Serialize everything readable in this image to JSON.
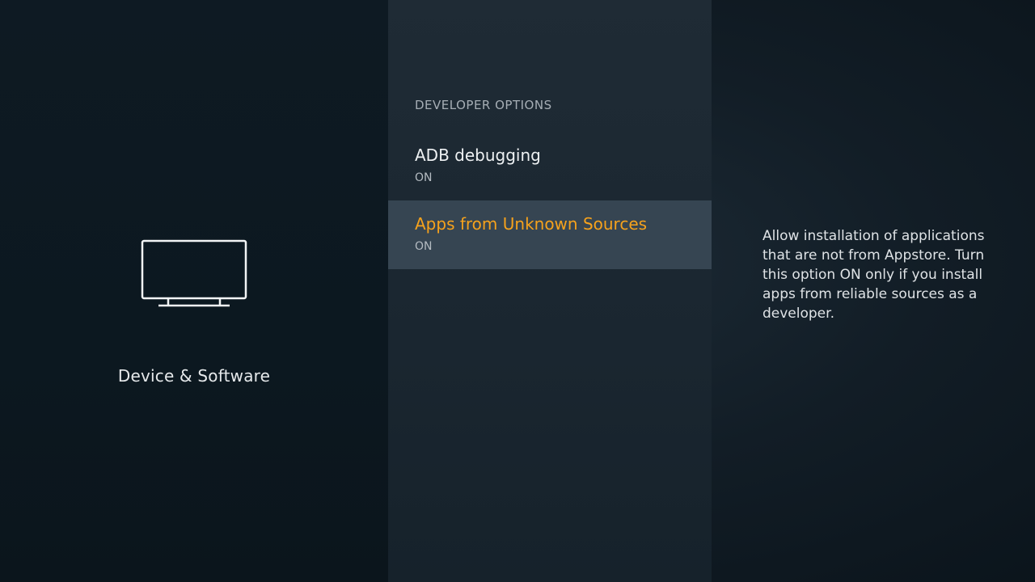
{
  "category": {
    "icon": "tv-icon",
    "label": "Device & Software"
  },
  "section": {
    "header": "DEVELOPER OPTIONS",
    "items": [
      {
        "title": "ADB debugging",
        "status": "ON",
        "selected": false
      },
      {
        "title": "Apps from Unknown Sources",
        "status": "ON",
        "selected": true
      }
    ]
  },
  "description": "Allow installation of applications that are not from Appstore. Turn this option ON only if you install apps from reliable sources as a developer.",
  "colors": {
    "accent": "#f6a21c",
    "selected_background": "#364552"
  }
}
